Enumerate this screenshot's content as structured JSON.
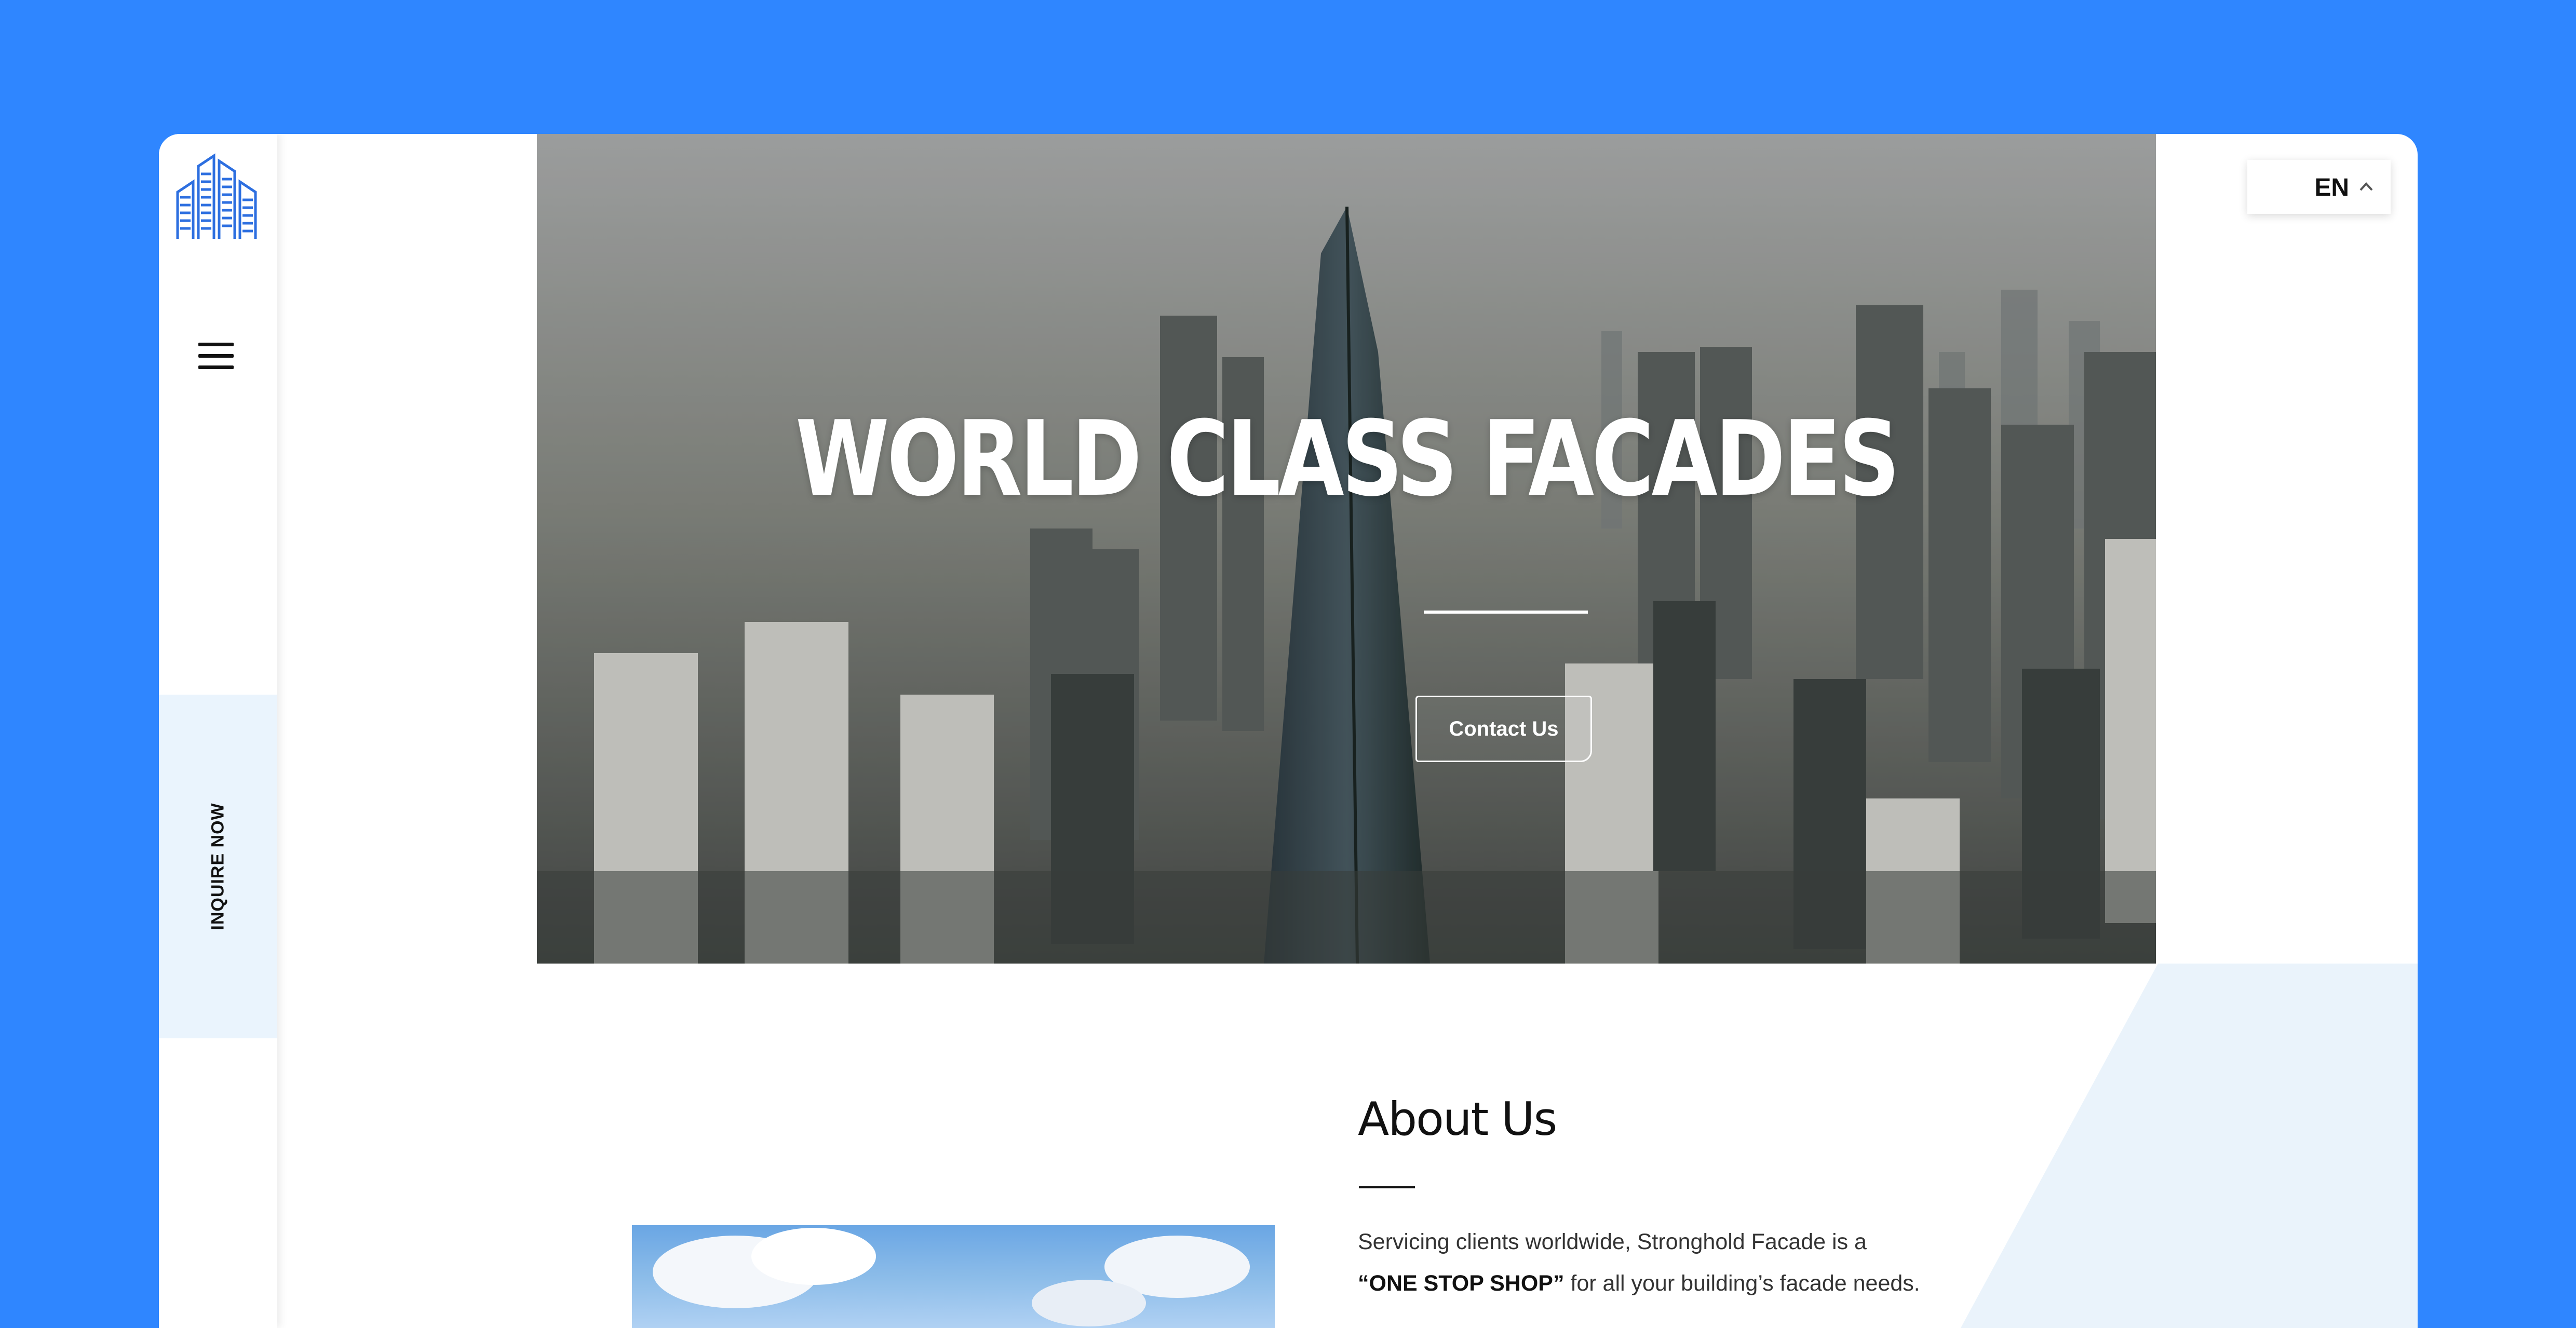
{
  "sidebar": {
    "logo_icon": "building-logo-icon",
    "menu_icon": "hamburger-menu-icon",
    "inquire_label": "INQUIRE NOW"
  },
  "hero": {
    "title": "WORLD CLASS FACADES",
    "contact_label": "Contact Us"
  },
  "language": {
    "selected": "EN",
    "icon": "chevron-up-icon"
  },
  "about": {
    "title": "About Us",
    "text_part1": "Servicing clients worldwide, Stronghold Facade is a",
    "text_bold": "“ONE STOP SHOP”",
    "text_part2": " for all your building’s facade needs."
  },
  "colors": {
    "page_background": "#2f86ff",
    "inquire_background": "#eaf4fd",
    "logo_blue": "#2d6fe0",
    "text_dark": "#111111"
  }
}
